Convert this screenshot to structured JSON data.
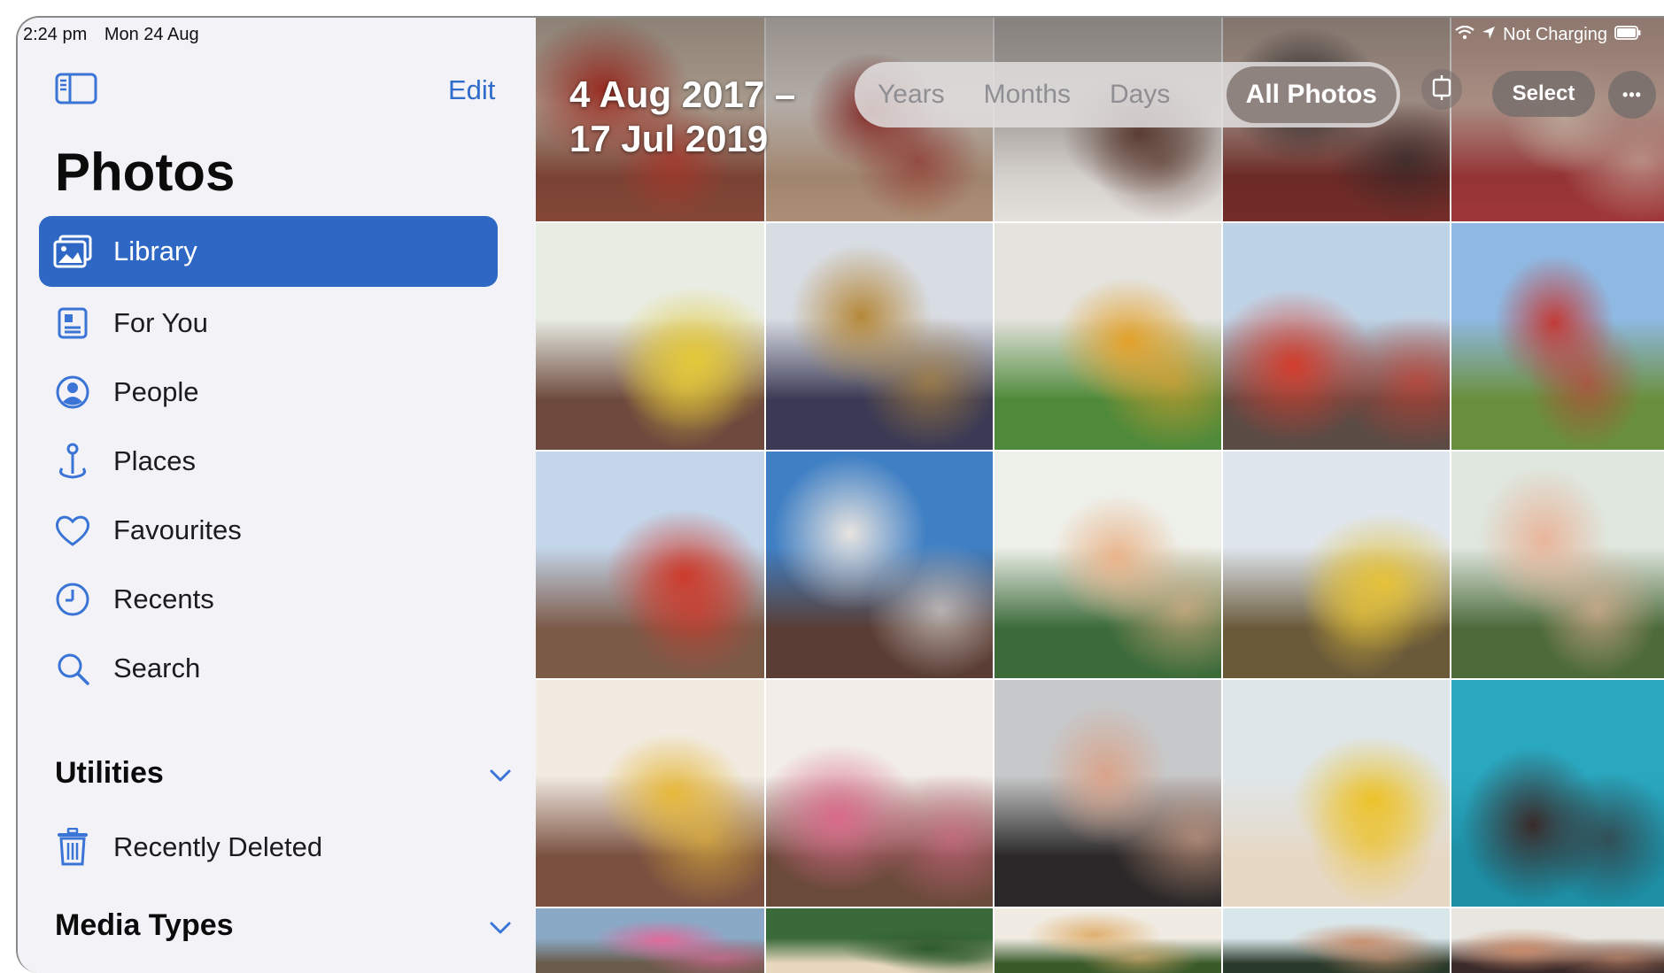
{
  "status_bar": {
    "time": "2:24 pm",
    "date": "Mon 24 Aug",
    "battery_text": "Not Charging"
  },
  "sidebar": {
    "edit_label": "Edit",
    "title": "Photos",
    "items": [
      {
        "label": "Library",
        "icon": "library-icon",
        "active": true
      },
      {
        "label": "For You",
        "icon": "for-you-icon",
        "active": false
      },
      {
        "label": "People",
        "icon": "people-icon",
        "active": false
      },
      {
        "label": "Places",
        "icon": "places-icon",
        "active": false
      },
      {
        "label": "Favourites",
        "icon": "heart-icon",
        "active": false
      },
      {
        "label": "Recents",
        "icon": "clock-icon",
        "active": false
      },
      {
        "label": "Search",
        "icon": "search-icon",
        "active": false
      }
    ],
    "utilities_label": "Utilities",
    "recently_deleted_label": "Recently Deleted",
    "media_types_label": "Media Types"
  },
  "library": {
    "date_range_line1": "4 Aug 2017 –",
    "date_range_line2": "17 Jul 2019",
    "segments": [
      "Years",
      "Months",
      "Days",
      "All Photos"
    ],
    "selected_segment": "All Photos",
    "select_label": "Select",
    "more_label": "•••"
  },
  "colors": {
    "accent": "#2f67c4",
    "edit_blue": "#2f6ccc",
    "sidebar_bg": "#f2f2f7",
    "icon_blue": "#3a74d6"
  },
  "photos": [
    {
      "row": 0,
      "col": 0,
      "sky": "#d8c6b4",
      "ground": "#8a4b3a",
      "accent": "#c93a2c"
    },
    {
      "row": 0,
      "col": 1,
      "sky": "#e7ddd6",
      "ground": "#b5967c",
      "accent": "#a0302a"
    },
    {
      "row": 0,
      "col": 2,
      "sky": "#cfc7c2",
      "ground": "#f0ece8",
      "accent": "#6d4a3e"
    },
    {
      "row": 0,
      "col": 3,
      "sky": "#c9b3a7",
      "ground": "#7a2f2a",
      "accent": "#2d2b2b"
    },
    {
      "row": 0,
      "col": 4,
      "sky": "#d9b6a8",
      "ground": "#a83a3c",
      "accent": "#e6c9b9"
    },
    {
      "row": 1,
      "col": 0,
      "sky": "#e8ede4",
      "ground": "#6e4a3e",
      "accent": "#e4c93a"
    },
    {
      "row": 1,
      "col": 1,
      "sky": "#d8dce3",
      "ground": "#3a3a55",
      "accent": "#b5883a"
    },
    {
      "row": 1,
      "col": 2,
      "sky": "#e4e3de",
      "ground": "#4f8a3a",
      "accent": "#e3a12a"
    },
    {
      "row": 1,
      "col": 3,
      "sky": "#bfd3e6",
      "ground": "#5a4b45",
      "accent": "#d23c2c"
    },
    {
      "row": 1,
      "col": 4,
      "sky": "#8fb9e3",
      "ground": "#6a8f3c",
      "accent": "#c23b36"
    },
    {
      "row": 2,
      "col": 0,
      "sky": "#c4d6ea",
      "ground": "#7c5a48",
      "accent": "#cc3b2c"
    },
    {
      "row": 2,
      "col": 1,
      "sky": "#3f7fc4",
      "ground": "#5a3e35",
      "accent": "#e8e4e0"
    },
    {
      "row": 2,
      "col": 2,
      "sky": "#eef0ea",
      "ground": "#3c6b3a",
      "accent": "#e9b48a"
    },
    {
      "row": 2,
      "col": 3,
      "sky": "#dfe6ee",
      "ground": "#6a5a3a",
      "accent": "#e5c23a"
    },
    {
      "row": 2,
      "col": 4,
      "sky": "#dfe7df",
      "ground": "#4c6a3a",
      "accent": "#e8b59a"
    },
    {
      "row": 3,
      "col": 0,
      "sky": "#f1ebe2",
      "ground": "#7a5040",
      "accent": "#e6b83a"
    },
    {
      "row": 3,
      "col": 1,
      "sky": "#f2ede8",
      "ground": "#6a4a3a",
      "accent": "#d96a8a"
    },
    {
      "row": 3,
      "col": 2,
      "sky": "#c7c8c9",
      "ground": "#2a2828",
      "accent": "#d9a48a"
    },
    {
      "row": 3,
      "col": 3,
      "sky": "#dfe6ea",
      "ground": "#e6d8c4",
      "accent": "#ecc22a"
    },
    {
      "row": 3,
      "col": 4,
      "sky": "#2aa8c0",
      "ground": "#1d8ea4",
      "accent": "#3a2b2a"
    },
    {
      "row": 4,
      "col": 0,
      "sky": "#8aa9c6",
      "ground": "#6a5a4a",
      "accent": "#e06a9a"
    },
    {
      "row": 4,
      "col": 1,
      "sky": "#3a6a3a",
      "ground": "#e8d8c0",
      "accent": "#2e5a2e"
    },
    {
      "row": 4,
      "col": 2,
      "sky": "#f0ece4",
      "ground": "#3a5a2a",
      "accent": "#e0b070"
    },
    {
      "row": 4,
      "col": 3,
      "sky": "#d9e6ea",
      "ground": "#2a3a2a",
      "accent": "#c89070"
    },
    {
      "row": 4,
      "col": 4,
      "sky": "#e8e6e0",
      "ground": "#3a2a2a",
      "accent": "#c88a6a"
    }
  ]
}
